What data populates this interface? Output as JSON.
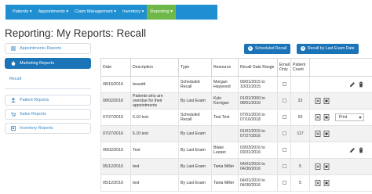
{
  "nav": {
    "items": [
      {
        "label": "Patients ▾"
      },
      {
        "label": "Appointments ▾"
      },
      {
        "label": "Claim Management ▾"
      },
      {
        "label": "Inventory ▾"
      },
      {
        "label": "Reporting ▾",
        "active": true
      }
    ],
    "active_color": "#6eb84a",
    "bar_color": "#1f8fd1"
  },
  "page_title": "Reporting: My Reports: Recall",
  "actions": {
    "scheduled_recall": "Scheduled Recall",
    "recall_by_last_exam": "Recall by Last Exam Date"
  },
  "sidebar": {
    "appointments_reports": "Appointments Reports",
    "marketing_reports": "Marketing Reports",
    "recall": "Recall",
    "patient_reports": "Patient Reports",
    "sales_reports": "Sales Reports",
    "inventory_reports": "Inventory Reports"
  },
  "table": {
    "headers": [
      "Date",
      "Description",
      "Type",
      "Resource",
      "Recall Date Range",
      "Email Only",
      "Patient Count",
      ""
    ],
    "rows": [
      {
        "date": "08/16/2016",
        "desc": "tesssttt",
        "type": "Scheduled Recall",
        "resource": "Morgan Haywood",
        "range": "09/01/2015 to 10/31/2015",
        "count": "",
        "actions": "edit-delete"
      },
      {
        "date": "08/02/2016",
        "desc": "Patients who are overdue for their appointments",
        "type": "By Last Exam",
        "resource": "Kyle Kerrigan",
        "range": "01/01/2000 to 08/01/2016",
        "count": "23",
        "actions": "docs"
      },
      {
        "date": "07/27/2016",
        "desc": "6.10 test",
        "type": "Scheduled Recall",
        "resource": "Test Test",
        "range": "07/01/2016 to 07/16/2018",
        "count": "63",
        "actions": "docs-print"
      },
      {
        "date": "07/27/2016",
        "desc": "6.10 test",
        "type": "By Last Exam",
        "resource": "",
        "range": "01/01/2015 to 07/27/2016",
        "count": "117",
        "actions": "docs"
      },
      {
        "date": "06/02/2016",
        "desc": "Test",
        "type": "By Last Exam",
        "resource": "Blake Leeper",
        "range": "03/03/2016 to 03/31/2016",
        "count": "",
        "actions": "edit-delete"
      },
      {
        "date": "05/12/2016",
        "desc": "test",
        "type": "By Last Exam",
        "resource": "Tania Miller",
        "range": "04/01/2016 to 04/30/2016",
        "count": "5",
        "actions": "docs"
      },
      {
        "date": "05/12/2016",
        "desc": "test",
        "type": "By Last Exam",
        "resource": "Tania Miller",
        "range": "04/01/2016 to 04/30/2016",
        "count": "5",
        "actions": "docs"
      }
    ],
    "print_option": "Print"
  }
}
